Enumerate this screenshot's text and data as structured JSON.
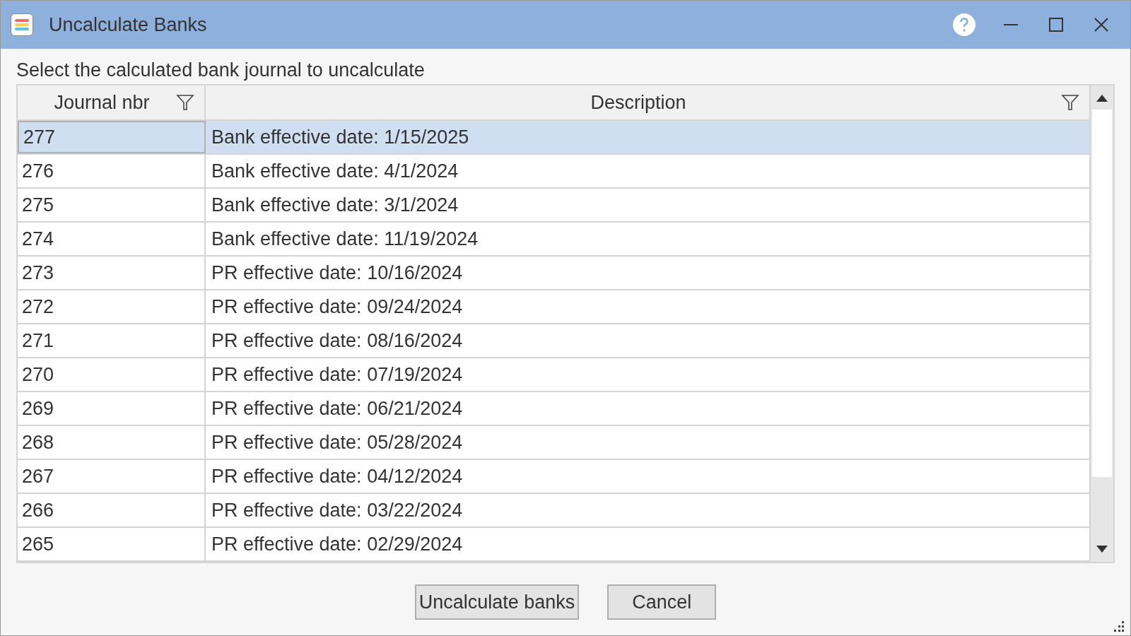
{
  "window": {
    "title": "Uncalculate Banks"
  },
  "instruction": "Select the calculated bank journal to uncalculate",
  "table": {
    "columns": [
      {
        "label": "Journal nbr",
        "filter": true
      },
      {
        "label": "Description",
        "filter": true
      }
    ],
    "rows": [
      {
        "journal_nbr": "277",
        "description": "Bank effective date: 1/15/2025",
        "selected": true
      },
      {
        "journal_nbr": "276",
        "description": "Bank effective date: 4/1/2024",
        "selected": false
      },
      {
        "journal_nbr": "275",
        "description": "Bank effective date: 3/1/2024",
        "selected": false
      },
      {
        "journal_nbr": "274",
        "description": "Bank effective date: 11/19/2024",
        "selected": false
      },
      {
        "journal_nbr": "273",
        "description": "PR effective date: 10/16/2024",
        "selected": false
      },
      {
        "journal_nbr": "272",
        "description": "PR effective date: 09/24/2024",
        "selected": false
      },
      {
        "journal_nbr": "271",
        "description": "PR effective date: 08/16/2024",
        "selected": false
      },
      {
        "journal_nbr": "270",
        "description": "PR effective date: 07/19/2024",
        "selected": false
      },
      {
        "journal_nbr": "269",
        "description": "PR effective date: 06/21/2024",
        "selected": false
      },
      {
        "journal_nbr": "268",
        "description": "PR effective date: 05/28/2024",
        "selected": false
      },
      {
        "journal_nbr": "267",
        "description": "PR effective date: 04/12/2024",
        "selected": false
      },
      {
        "journal_nbr": "266",
        "description": "PR effective date: 03/22/2024",
        "selected": false
      },
      {
        "journal_nbr": "265",
        "description": "PR effective date: 02/29/2024",
        "selected": false
      }
    ]
  },
  "buttons": [
    {
      "label": "Uncalculate banks",
      "kind": "primary"
    },
    {
      "label": "Cancel",
      "kind": "cancel"
    }
  ]
}
